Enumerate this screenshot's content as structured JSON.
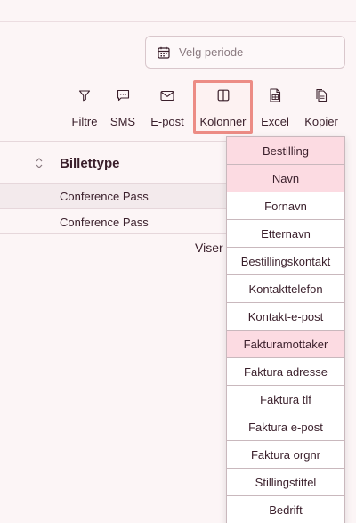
{
  "period": {
    "placeholder": "Velg periode",
    "icon": "calendar-icon"
  },
  "toolbar": [
    {
      "label": "Filtre",
      "icon": "filter-icon"
    },
    {
      "label": "SMS",
      "icon": "sms-icon"
    },
    {
      "label": "E-post",
      "icon": "envelope-icon"
    },
    {
      "label": "Kolonner",
      "icon": "columns-icon",
      "active": true
    },
    {
      "label": "Excel",
      "icon": "excel-icon"
    },
    {
      "label": "Kopier",
      "icon": "copy-icon"
    }
  ],
  "table": {
    "column_header": "Billettype",
    "rows": [
      "Conference Pass",
      "Conference Pass"
    ],
    "footer_text": "Viser"
  },
  "columns_menu": [
    {
      "label": "Bestilling",
      "selected": true
    },
    {
      "label": "Navn",
      "selected": true
    },
    {
      "label": "Fornavn",
      "selected": false
    },
    {
      "label": "Etternavn",
      "selected": false
    },
    {
      "label": "Bestillingskontakt",
      "selected": false
    },
    {
      "label": "Kontakttelefon",
      "selected": false
    },
    {
      "label": "Kontakt-e-post",
      "selected": false
    },
    {
      "label": "Fakturamottaker",
      "selected": true
    },
    {
      "label": "Faktura adresse",
      "selected": false
    },
    {
      "label": "Faktura tlf",
      "selected": false
    },
    {
      "label": "Faktura e-post",
      "selected": false
    },
    {
      "label": "Faktura orgnr",
      "selected": false
    },
    {
      "label": "Stillingstittel",
      "selected": false
    },
    {
      "label": "Bedrift",
      "selected": false
    }
  ],
  "colors": {
    "background": "#fcf5f6",
    "text": "#3a1f2b",
    "active_outline": "#ec8c85",
    "selected_item": "#fcdbe2"
  }
}
